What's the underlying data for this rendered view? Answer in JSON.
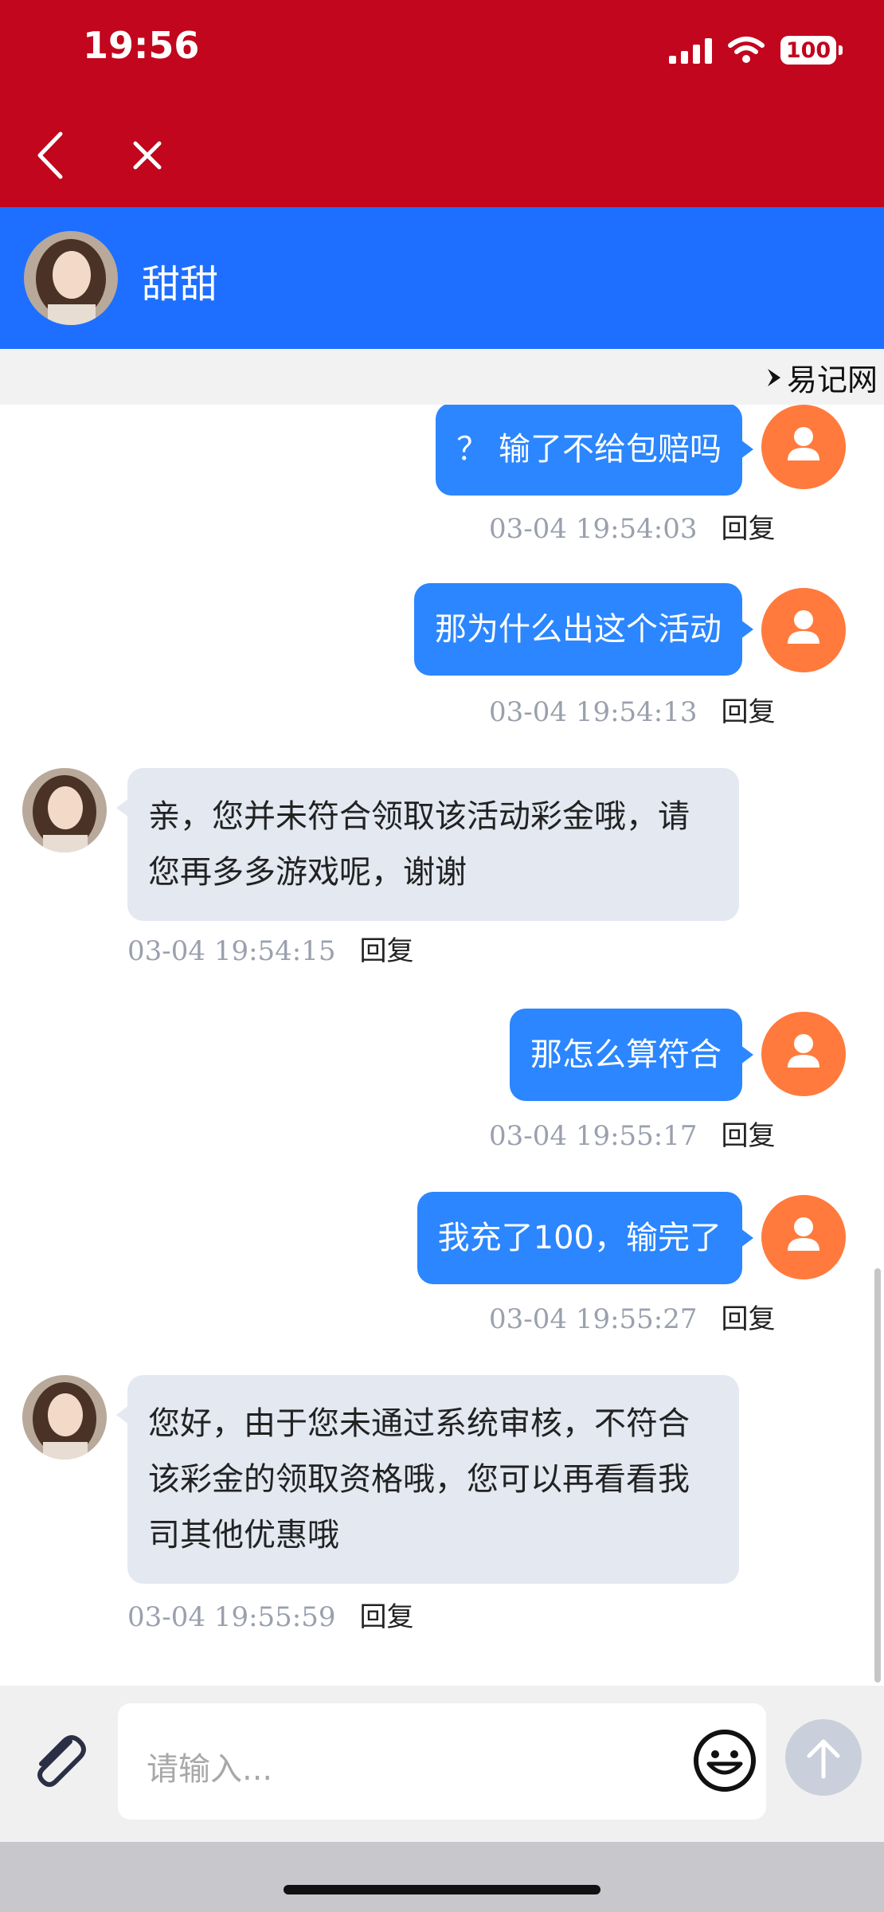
{
  "status_bar": {
    "time": "19:56",
    "battery": "100"
  },
  "nav": {
    "back_icon": "chevron-left-icon",
    "close_icon": "close-icon"
  },
  "chat": {
    "contact_name": "甜甜"
  },
  "brand": {
    "text": "易记网"
  },
  "messages": [
    {
      "side": "out",
      "text": "？ 输了不给包赔吗",
      "timestamp": "03-04 19:54:03",
      "reply": "回复"
    },
    {
      "side": "out",
      "text": "那为什么出这个活动",
      "timestamp": "03-04 19:54:13",
      "reply": "回复"
    },
    {
      "side": "in",
      "lines": [
        "亲，您并未符合领取该活动彩金哦，请",
        "您再多多游戏呢，谢谢"
      ],
      "timestamp": "03-04 19:54:15",
      "reply": "回复"
    },
    {
      "side": "out",
      "text": "那怎么算符合",
      "timestamp": "03-04 19:55:17",
      "reply": "回复"
    },
    {
      "side": "out",
      "text": "我充了100，输完了",
      "timestamp": "03-04 19:55:27",
      "reply": "回复"
    },
    {
      "side": "in",
      "lines": [
        "您好，由于您未通过系统审核，不符合",
        "该彩金的领取资格哦，您可以再看看我",
        "司其他优惠哦"
      ],
      "timestamp": "03-04 19:55:59",
      "reply": "回复"
    }
  ],
  "input": {
    "placeholder": "请输入..."
  },
  "colors": {
    "status_bar": "#c1061d",
    "header": "#1e6fff",
    "outgoing_bubble": "#2b86ff",
    "incoming_bubble": "#e3e8f1",
    "user_avatar": "#ff7a3c"
  }
}
